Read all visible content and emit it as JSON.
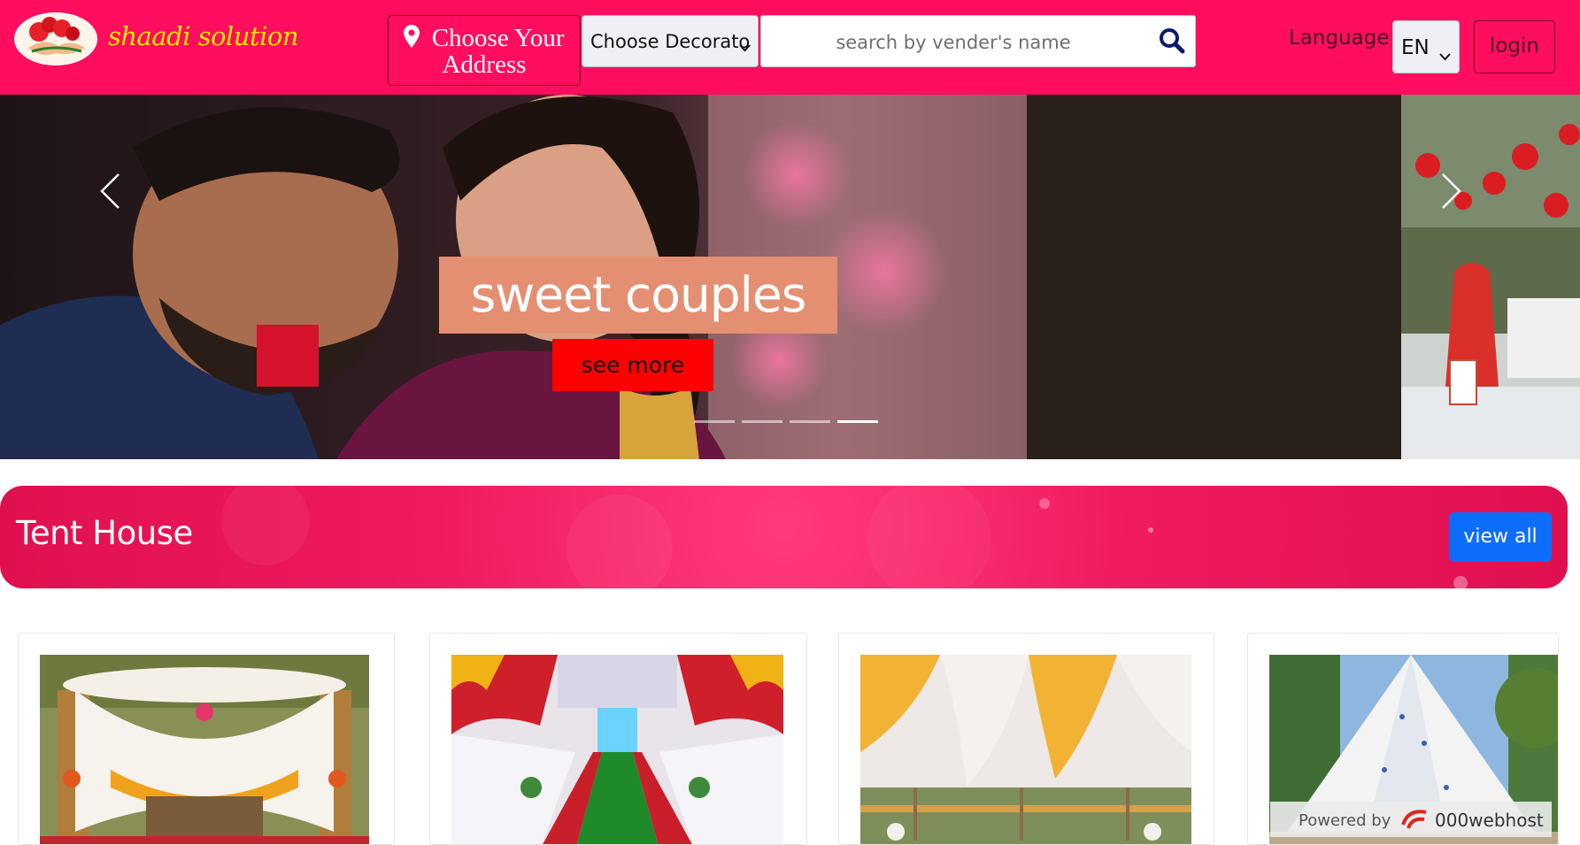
{
  "header": {
    "logo_text": "shaadi solution",
    "address_button": "Choose Your Address",
    "address_line1": "Choose Your",
    "address_line2": "Address",
    "category_select": "Choose Decorato",
    "search_placeholder": "search by vender's name",
    "language_label": "Language",
    "language_value": "EN",
    "login_label": "login",
    "brand_color": "#ff0d5e",
    "logo_text_color": "#ffe900"
  },
  "carousel": {
    "caption": "sweet couples",
    "button_label": "see more",
    "slide_count": 4,
    "active_slide": 4
  },
  "section": {
    "title": "Tent House",
    "view_all_label": "view all"
  },
  "cards": [
    {
      "name": "tent-card-1"
    },
    {
      "name": "tent-card-2"
    },
    {
      "name": "tent-card-3"
    },
    {
      "name": "tent-card-4"
    }
  ],
  "watermark": {
    "powered_by": "Powered by",
    "brand": "000webhost"
  }
}
